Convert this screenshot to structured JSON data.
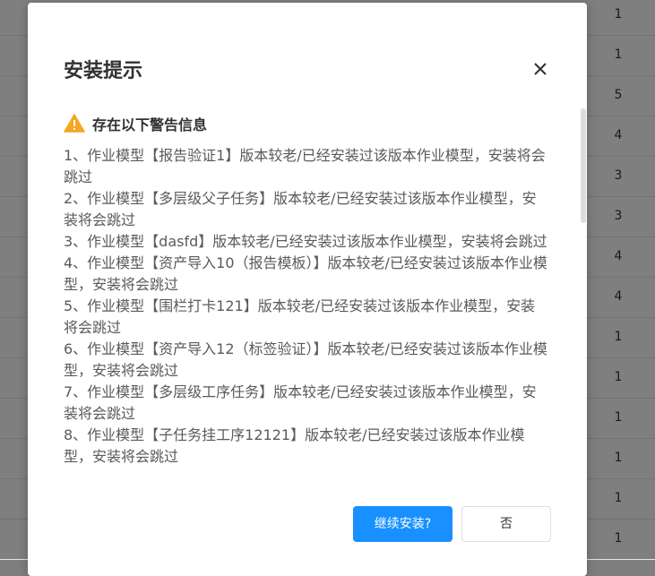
{
  "background_table": {
    "values": [
      "1",
      "1",
      "5",
      "4",
      "3",
      "3",
      "4",
      "4",
      "1",
      "1",
      "1",
      "1",
      "1",
      "1"
    ]
  },
  "dialog": {
    "title": "安装提示",
    "warning_title": "存在以下警告信息",
    "messages": [
      "1、作业模型【报告验证1】版本较老/已经安装过该版本作业模型，安装将会跳过",
      "2、作业模型【多层级父子任务】版本较老/已经安装过该版本作业模型，安装将会跳过",
      "3、作业模型【dasfd】版本较老/已经安装过该版本作业模型，安装将会跳过",
      "4、作业模型【资产导入10（报告模板）】版本较老/已经安装过该版本作业模型，安装将会跳过",
      "5、作业模型【围栏打卡121】版本较老/已经安装过该版本作业模型，安装将会跳过",
      "6、作业模型【资产导入12（标签验证）】版本较老/已经安装过该版本作业模型，安装将会跳过",
      "7、作业模型【多层级工序任务】版本较老/已经安装过该版本作业模型，安装将会跳过",
      "8、作业模型【子任务挂工序12121】版本较老/已经安装过该版本作业模型，安装将会跳过"
    ],
    "continue_label": "继续安装?",
    "no_label": "否"
  }
}
